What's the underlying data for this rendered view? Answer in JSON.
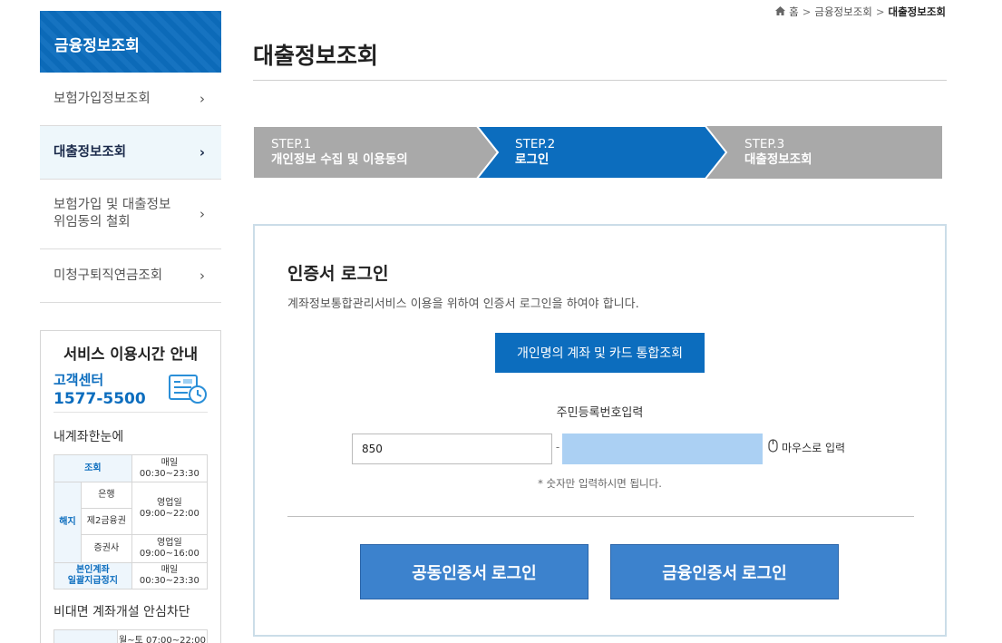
{
  "sidebar": {
    "title": "금융정보조회",
    "items": [
      {
        "label_lines": [
          "보험가입정보조회"
        ],
        "active": false
      },
      {
        "label_lines": [
          "대출정보조회"
        ],
        "active": true
      },
      {
        "label_lines": [
          "보험가입 및 대출정보",
          "위임동의 철회"
        ],
        "active": false
      },
      {
        "label_lines": [
          "미청구퇴직연금조회"
        ],
        "active": false
      }
    ],
    "chevron": "›"
  },
  "service_box": {
    "title": "서비스 이용시간 안내",
    "customer_center_label": "고객센터",
    "customer_center_phone": "1577-5500",
    "section1_title": "내계좌한눈에",
    "table": {
      "row_inquiry": {
        "label": "조회",
        "hours": [
          "매일",
          "00:30~23:30"
        ]
      },
      "cancel_label": "해지",
      "row_bank": {
        "label": "은행",
        "hours": [
          "영업일",
          "09:00~22:00"
        ]
      },
      "row_second": {
        "label": "제2금융권"
      },
      "row_securities": {
        "label": "증권사",
        "hours": [
          "영업일",
          "09:00~16:00"
        ]
      },
      "row_suspend": {
        "label": [
          "본인계좌",
          "일괄지급정지"
        ],
        "hours": [
          "매일",
          "00:30~23:30"
        ]
      }
    },
    "section2_title": "비대면 계좌개설 안심차단",
    "section2_row_hours": "월~토 07:00~22:00"
  },
  "breadcrumb": {
    "home": "홈",
    "level1": "금융정보조회",
    "current": "대출정보조회",
    "separator": ">"
  },
  "page_title": "대출정보조회",
  "steps": [
    {
      "num": "STEP.1",
      "name": "개인정보 수집 및 이용동의",
      "active": false
    },
    {
      "num": "STEP.2",
      "name": "로그인",
      "active": true
    },
    {
      "num": "STEP.3",
      "name": "대출정보조회",
      "active": false
    }
  ],
  "login": {
    "title": "인증서 로그인",
    "description": "계좌정보통합관리서비스 이용을 위하여 인증서 로그인을 하여야 합니다.",
    "integrated_button": "개인명의 계좌 및 카드 통합조회",
    "rrn_label": "주민등록번호입력",
    "rrn_first_value": "850",
    "rrn_dash": "-",
    "mouse_input_label": "마우스로 입력",
    "hint": "* 숫자만 입력하시면 됩니다.",
    "joint_cert_button": "공동인증서 로그인",
    "financial_cert_button": "금융인증서 로그인"
  },
  "colors": {
    "primary": "#0c6dbe",
    "step_inactive": "#a9a9a9",
    "step_active": "#0c6dbe",
    "login_button": "#3c82cd",
    "rrn_second_bg": "#abd0f3"
  },
  "icons": {
    "home": "home-icon",
    "chevron": "chevron-right-icon",
    "customer_center": "customer-center-clock-icon",
    "mouse": "mouse-icon"
  }
}
